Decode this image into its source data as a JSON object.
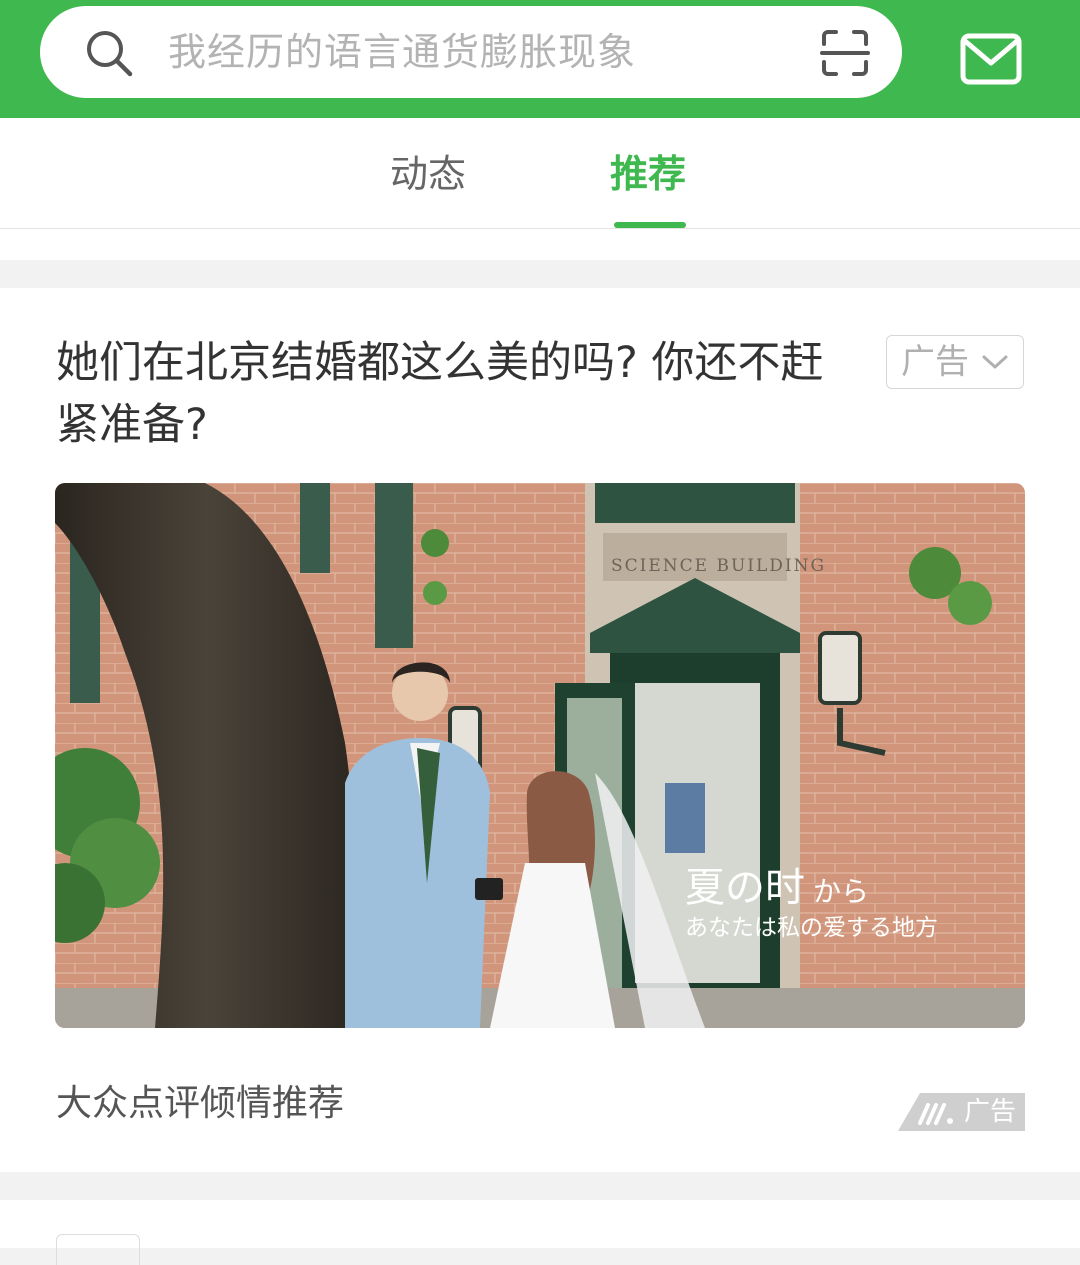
{
  "search": {
    "placeholder": "我经历的语言通货膨胀现象",
    "icons": [
      "search-icon",
      "scan-icon"
    ]
  },
  "header": {
    "mail_icon": "mail-icon",
    "brand_color": "#3fb84f"
  },
  "tabs": [
    {
      "label": "动态",
      "active": false
    },
    {
      "label": "推荐",
      "active": true
    }
  ],
  "feed": {
    "ad_card": {
      "title": "她们在北京结婚都这么美的吗? 你还不赶紧准备?",
      "ad_tag": "广告",
      "image_caption": {
        "line1_main": "夏の时",
        "line1_suffix": "から",
        "line2": "あなたは私の爱する地方",
        "sign": "SCIENCE BUILDING"
      },
      "source": "大众点评倾情推荐",
      "ad_badge": "广告"
    }
  }
}
